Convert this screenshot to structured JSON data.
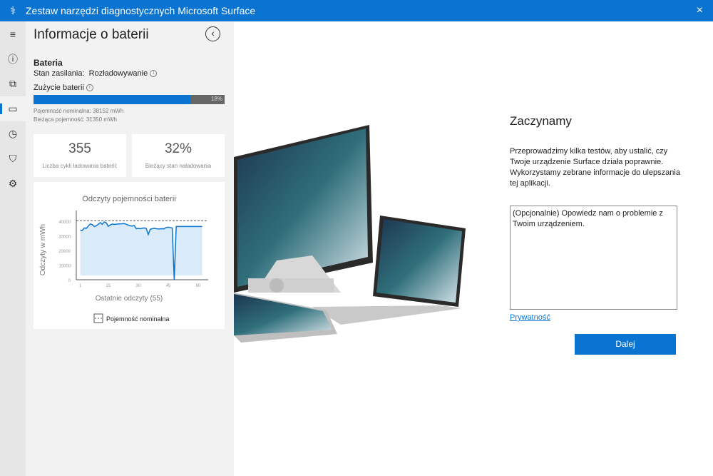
{
  "window": {
    "title": "Zestaw narzędzi diagnostycznych Microsoft Surface",
    "close_icon": "×"
  },
  "rail": {
    "items": [
      {
        "name": "menu-icon",
        "glyph": "≡"
      },
      {
        "name": "info-icon",
        "glyph": "ⓘ"
      },
      {
        "name": "devices-icon",
        "glyph": "⧉"
      },
      {
        "name": "battery-icon",
        "glyph": "▭"
      },
      {
        "name": "clock-icon",
        "glyph": "◷"
      },
      {
        "name": "shield-icon",
        "glyph": "⛉"
      },
      {
        "name": "gear-icon",
        "glyph": "⚙"
      }
    ]
  },
  "panel": {
    "title": "Informacje o baterii",
    "back_glyph": "‹",
    "section": "Bateria",
    "power_state_label": "Stan zasilania:",
    "power_state": "Rozładowywanie",
    "wear_label": "Zużycie baterii",
    "wear_percent": 18,
    "wear_text": "18%",
    "nominal": "Pojemność nominalna:  38152  mWh",
    "current": "Bieżąca pojemność:  31350  mWh",
    "cycles_value": "355",
    "cycles_label": "Liczba cykli ładowania baterii:",
    "charge_value": "32%",
    "charge_label": "Bieżący stan naładowania"
  },
  "chart_data": {
    "type": "line",
    "title": "Odczyty pojemności baterii",
    "xlabel": "Ostatnie odczyty (55)",
    "ylabel": "Odczyty w mWh",
    "xticks": [
      1,
      15,
      30,
      45,
      60
    ],
    "yticks": [
      0,
      10000,
      20000,
      30000,
      40000
    ],
    "xlim": [
      -1,
      65
    ],
    "ylim": [
      0,
      45000
    ],
    "nominal": 40500,
    "legend": "Pojemność nominalna",
    "x": [
      1,
      2,
      3,
      4,
      5,
      6,
      7,
      8,
      9,
      10,
      11,
      12,
      13,
      14,
      15,
      16,
      17,
      18,
      19,
      20,
      21,
      22,
      23,
      24,
      25,
      26,
      27,
      28,
      29,
      30,
      31,
      32,
      33,
      34,
      35,
      36,
      37,
      38,
      39,
      40,
      41,
      42,
      43,
      44,
      45,
      46,
      47,
      48,
      49,
      50,
      51,
      52,
      53,
      54,
      55,
      56,
      57,
      58,
      59,
      60,
      61,
      62
    ],
    "values": [
      34000,
      33800,
      35500,
      35200,
      36800,
      38200,
      37800,
      36500,
      37000,
      38000,
      39200,
      38000,
      39600,
      39000,
      36600,
      37500,
      38200,
      37900,
      38100,
      38200,
      38300,
      38400,
      38500,
      38000,
      37500,
      37000,
      36800,
      37200,
      35000,
      35200,
      35000,
      35300,
      35500,
      35200,
      31000,
      34600,
      35000,
      35200,
      35000,
      34800,
      34900,
      35000,
      34900,
      35800,
      36000,
      35800,
      35500,
      0,
      36500,
      36500,
      36500,
      36500,
      36500,
      36500,
      36500,
      36500,
      36500,
      36500,
      36500,
      36500,
      36500,
      36500
    ]
  },
  "main": {
    "heading": "Zaczynamy",
    "description": "Przeprowadzimy kilka testów, aby ustalić, czy Twoje urządzenie Surface działa poprawnie. Wykorzystamy zebrane informacje do ulepszania tej aplikacji.",
    "feedback_placeholder": "(Opcjonalnie) Opowiedz nam o problemie z Twoim urządzeniem.",
    "privacy_link": "Prywatność",
    "next_button": "Dalej"
  },
  "colors": {
    "accent": "#0a74d0",
    "chart_fill": "#d9eaf8"
  }
}
